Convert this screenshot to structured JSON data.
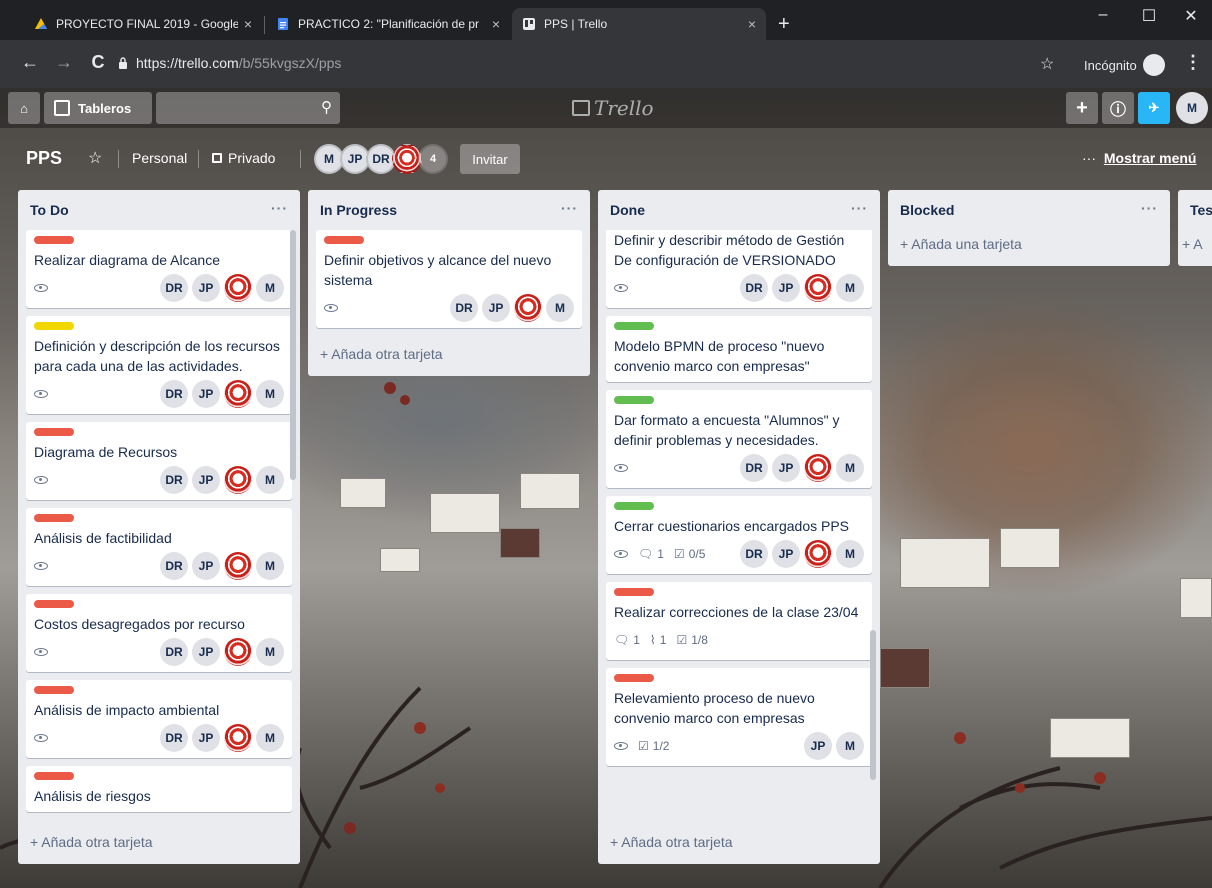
{
  "browser": {
    "tabs": [
      {
        "title": "PROYECTO FINAL 2019 - Google",
        "close": "×"
      },
      {
        "title": "PRACTICO 2: \"Planificación de pr",
        "close": "×"
      },
      {
        "title": "PPS | Trello",
        "close": "×"
      }
    ],
    "new_tab": "+",
    "window_controls": {
      "minimize": "–",
      "maximize": "☐",
      "close": "✕"
    },
    "nav": {
      "back": "←",
      "forward": "→",
      "reload": "C"
    },
    "url_host": "https://trello.com",
    "url_path": "/b/55kvgszX/pps",
    "bookmark": "☆",
    "incognito_label": "Incógnito",
    "menu": "⋮"
  },
  "header": {
    "home_icon": "⌂",
    "boards_label": "Tableros",
    "search_icon": "⚲",
    "logo_text": "Trello",
    "plus": "+",
    "info": "ⓘ",
    "notif": "✈",
    "user_initial": "M"
  },
  "board": {
    "name": "PPS",
    "star": "☆",
    "team": "Personal",
    "visibility": "Privado",
    "members": [
      "M",
      "JP",
      "DR"
    ],
    "member_count": "4",
    "invite_label": "Invitar",
    "menu_dots": "···",
    "menu_label": "Mostrar menú"
  },
  "lists": [
    {
      "title": "To Do",
      "more": "···",
      "add_card": "+ Añada otra tarjeta",
      "cards": [
        {
          "label_color": "#eb5a46",
          "title": "Realizar diagrama de Alcance",
          "watch": true,
          "members": [
            "DR",
            "JP",
            "crest",
            "M"
          ]
        },
        {
          "label_color": "#f2d600",
          "title": "Definición y descripción de los recursos para cada una de las actividades.",
          "watch": true,
          "members": [
            "DR",
            "JP",
            "crest",
            "M"
          ]
        },
        {
          "label_color": "#eb5a46",
          "title": "Diagrama de Recursos",
          "watch": true,
          "members": [
            "DR",
            "JP",
            "crest",
            "M"
          ]
        },
        {
          "label_color": "#eb5a46",
          "title": "Análisis de factibilidad",
          "watch": true,
          "members": [
            "DR",
            "JP",
            "crest",
            "M"
          ]
        },
        {
          "label_color": "#eb5a46",
          "title": "Costos desagregados por recurso",
          "watch": true,
          "members": [
            "DR",
            "JP",
            "crest",
            "M"
          ]
        },
        {
          "label_color": "#eb5a46",
          "title": "Análisis de impacto ambiental",
          "watch": true,
          "members": [
            "DR",
            "JP",
            "crest",
            "M"
          ]
        },
        {
          "label_color": "#eb5a46",
          "title": "Análisis de riesgos",
          "watch": false,
          "members": []
        }
      ]
    },
    {
      "title": "In Progress",
      "more": "···",
      "add_card": "+ Añada otra tarjeta",
      "cards": [
        {
          "label_color": "#eb5a46",
          "title": "Definir objetivos y alcance del nuevo sistema",
          "watch": true,
          "members": [
            "DR",
            "JP",
            "crest",
            "M"
          ]
        }
      ]
    },
    {
      "title": "Done",
      "more": "···",
      "add_card": "+ Añada otra tarjeta",
      "cards": [
        {
          "label_color": "",
          "title": "Definir y describir método de Gestión De configuración de VERSIONADO",
          "watch": true,
          "members": [
            "DR",
            "JP",
            "crest",
            "M"
          ]
        },
        {
          "label_color": "#61bd4f",
          "title": "Modelo BPMN de proceso \"nuevo convenio marco con empresas\"",
          "watch": false,
          "members": []
        },
        {
          "label_color": "#61bd4f",
          "title": "Dar formato a encuesta \"Alumnos\" y definir problemas y necesidades.",
          "watch": true,
          "members": [
            "DR",
            "JP",
            "crest",
            "M"
          ]
        },
        {
          "label_color": "#61bd4f",
          "title": "Cerrar cuestionarios encargados PPS",
          "watch": true,
          "comments": "1",
          "checklist": "0/5",
          "members": [
            "DR",
            "JP",
            "crest",
            "M"
          ]
        },
        {
          "label_color": "#eb5a46",
          "title": "Realizar correcciones de la clase 23/04",
          "watch": false,
          "comments": "1",
          "attachments": "1",
          "checklist": "1/8",
          "members": []
        },
        {
          "label_color": "#eb5a46",
          "title": "Relevamiento proceso de nuevo convenio marco con empresas",
          "watch": true,
          "checklist": "1/2",
          "members": [
            "JP",
            "M"
          ]
        }
      ]
    },
    {
      "title": "Blocked",
      "more": "···",
      "add_card": "+ Añada una tarjeta",
      "cards": []
    },
    {
      "title": "Tes",
      "more": "",
      "add_card": "+ A",
      "cards": []
    }
  ],
  "icons": {
    "comment": "🗨",
    "attachment": "⌇",
    "checklist": "☑"
  }
}
